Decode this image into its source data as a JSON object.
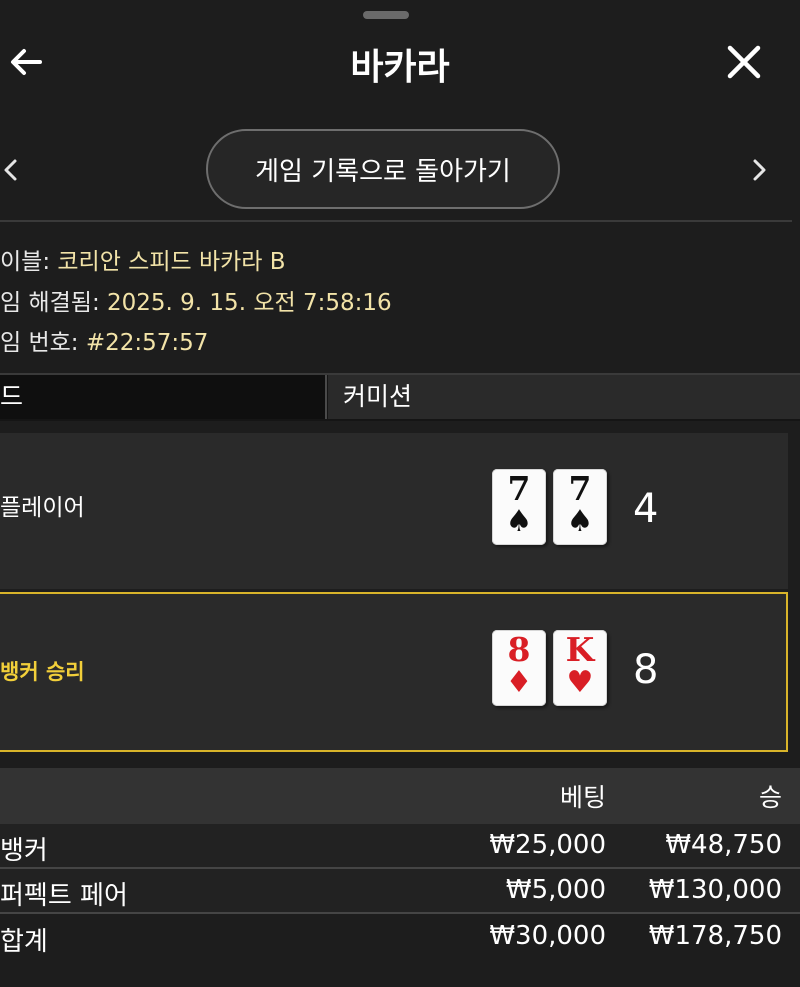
{
  "header": {
    "title": "바카라",
    "back_icon": "arrow-left-icon",
    "close_icon": "close-icon"
  },
  "nav": {
    "back_to_history_label": "게임 기록으로 돌아가기",
    "prev_icon": "chevron-left-icon",
    "next_icon": "chevron-right-icon"
  },
  "info": {
    "table_label": "이블:",
    "table_value": "코리안 스피드 바카라 B",
    "resolved_label": "임 해결됨:",
    "resolved_value": "2025. 9. 15. 오전 7:58:16",
    "game_no_label": "임 번호:",
    "game_no_value": "#22:57:57"
  },
  "tabs": [
    {
      "label": "드",
      "active": true
    },
    {
      "label": "커미션",
      "active": false
    }
  ],
  "hands": {
    "player": {
      "label": "플레이어",
      "score": "4",
      "cards": [
        {
          "rank": "7",
          "suit": "♠",
          "color": "black"
        },
        {
          "rank": "7",
          "suit": "♠",
          "color": "black"
        }
      ]
    },
    "banker": {
      "label": "뱅커 승리",
      "score": "8",
      "highlight": "#d8b42a",
      "cards": [
        {
          "rank": "8",
          "suit": "♦",
          "color": "red"
        },
        {
          "rank": "K",
          "suit": "♥",
          "color": "red"
        }
      ]
    }
  },
  "bets_table": {
    "headers": {
      "bet": "베팅",
      "win": "승"
    },
    "rows": [
      {
        "name": "뱅커",
        "bet": "₩25,000",
        "win": "₩48,750"
      },
      {
        "name": "퍼펙트 페어",
        "bet": "₩5,000",
        "win": "₩130,000"
      },
      {
        "name": "합계",
        "bet": "₩30,000",
        "win": "₩178,750"
      }
    ]
  },
  "colors": {
    "background": "#1d1d1d",
    "accent_gold": "#d8b42a",
    "info_value": "#f2e3a8",
    "card_red": "#d91e25"
  }
}
